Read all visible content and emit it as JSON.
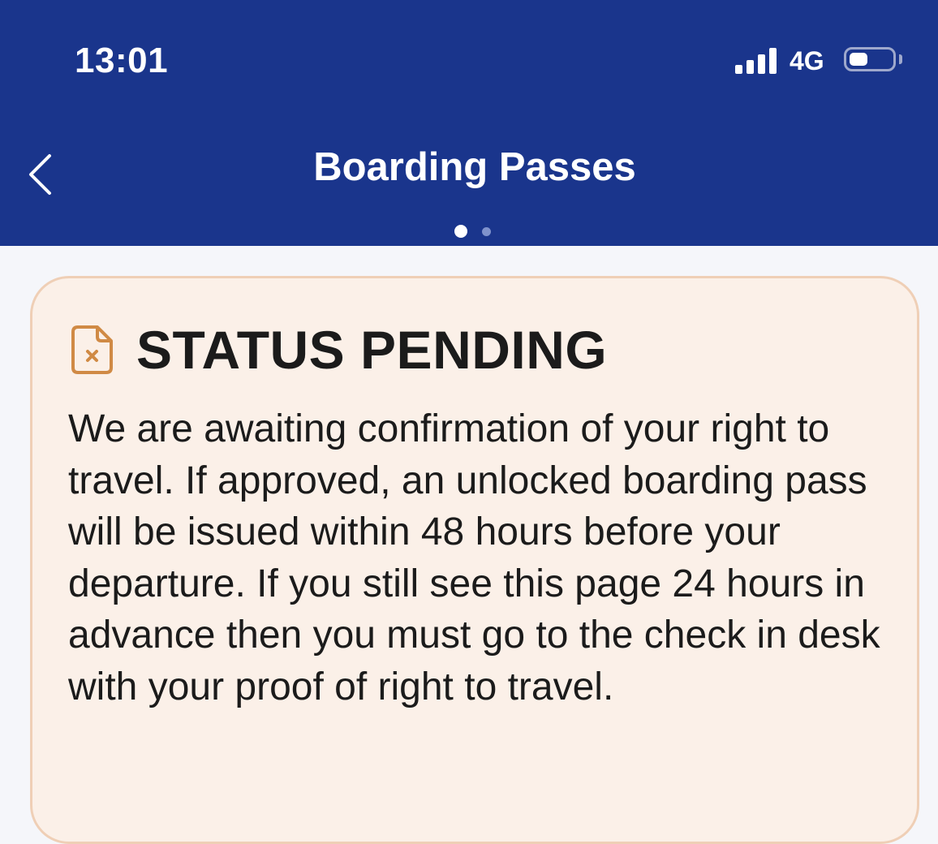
{
  "status_bar": {
    "time": "13:01",
    "network": "4G",
    "signal_icon": "cellular-signal-icon",
    "battery_icon": "battery-icon"
  },
  "nav": {
    "title": "Boarding Passes",
    "back_icon": "chevron-left-icon",
    "pages_total": 2,
    "page_active": 1
  },
  "status_card": {
    "icon": "document-cancel-icon",
    "title": "STATUS PENDING",
    "body": "We are awaiting confirmation of your right to travel. If approved, an unlocked boarding pass will be issued within 48 hours before your departure. If you still see this page 24 hours in advance then you must go to the check in desk with your proof of right to travel."
  },
  "colors": {
    "header_bg": "#1a358c",
    "page_bg": "#f5f6fa",
    "card_bg": "#fbf0e8",
    "card_border": "#efcfb6",
    "icon_accent": "#d08a45",
    "text": "#1b1b1b"
  }
}
